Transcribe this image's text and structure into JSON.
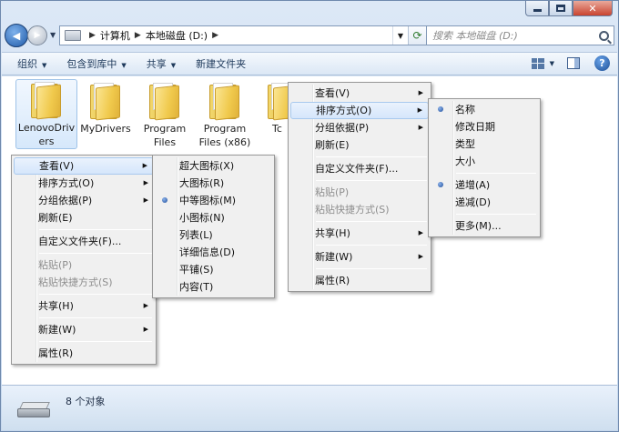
{
  "address": {
    "crumbs": [
      "计算机",
      "本地磁盘 (D:)"
    ],
    "search_placeholder": "搜索 本地磁盘 (D:)"
  },
  "toolbar": {
    "organize": "组织",
    "include_library": "包含到库中",
    "share": "共享",
    "new_folder": "新建文件夹"
  },
  "folders": [
    {
      "label": "LenovoDrivers"
    },
    {
      "label": "MyDrivers"
    },
    {
      "label": "Program Files"
    },
    {
      "label": "Program Files (x86)"
    },
    {
      "label": "Tc"
    }
  ],
  "status": {
    "count_text": "8 个对象"
  },
  "context_menu": {
    "items": [
      "查看(V)",
      "排序方式(O)",
      "分组依据(P)",
      "刷新(E)",
      "自定义文件夹(F)...",
      "粘贴(P)",
      "粘贴快捷方式(S)",
      "共享(H)",
      "新建(W)",
      "属性(R)"
    ]
  },
  "view_submenu": {
    "items": [
      "超大图标(X)",
      "大图标(R)",
      "中等图标(M)",
      "小图标(N)",
      "列表(L)",
      "详细信息(D)",
      "平铺(S)",
      "内容(T)"
    ],
    "selected": "中等图标(M)"
  },
  "sort_submenu": {
    "items": [
      "名称",
      "修改日期",
      "类型",
      "大小",
      "递增(A)",
      "递减(D)",
      "更多(M)..."
    ],
    "selected": [
      "名称",
      "递增(A)"
    ]
  }
}
